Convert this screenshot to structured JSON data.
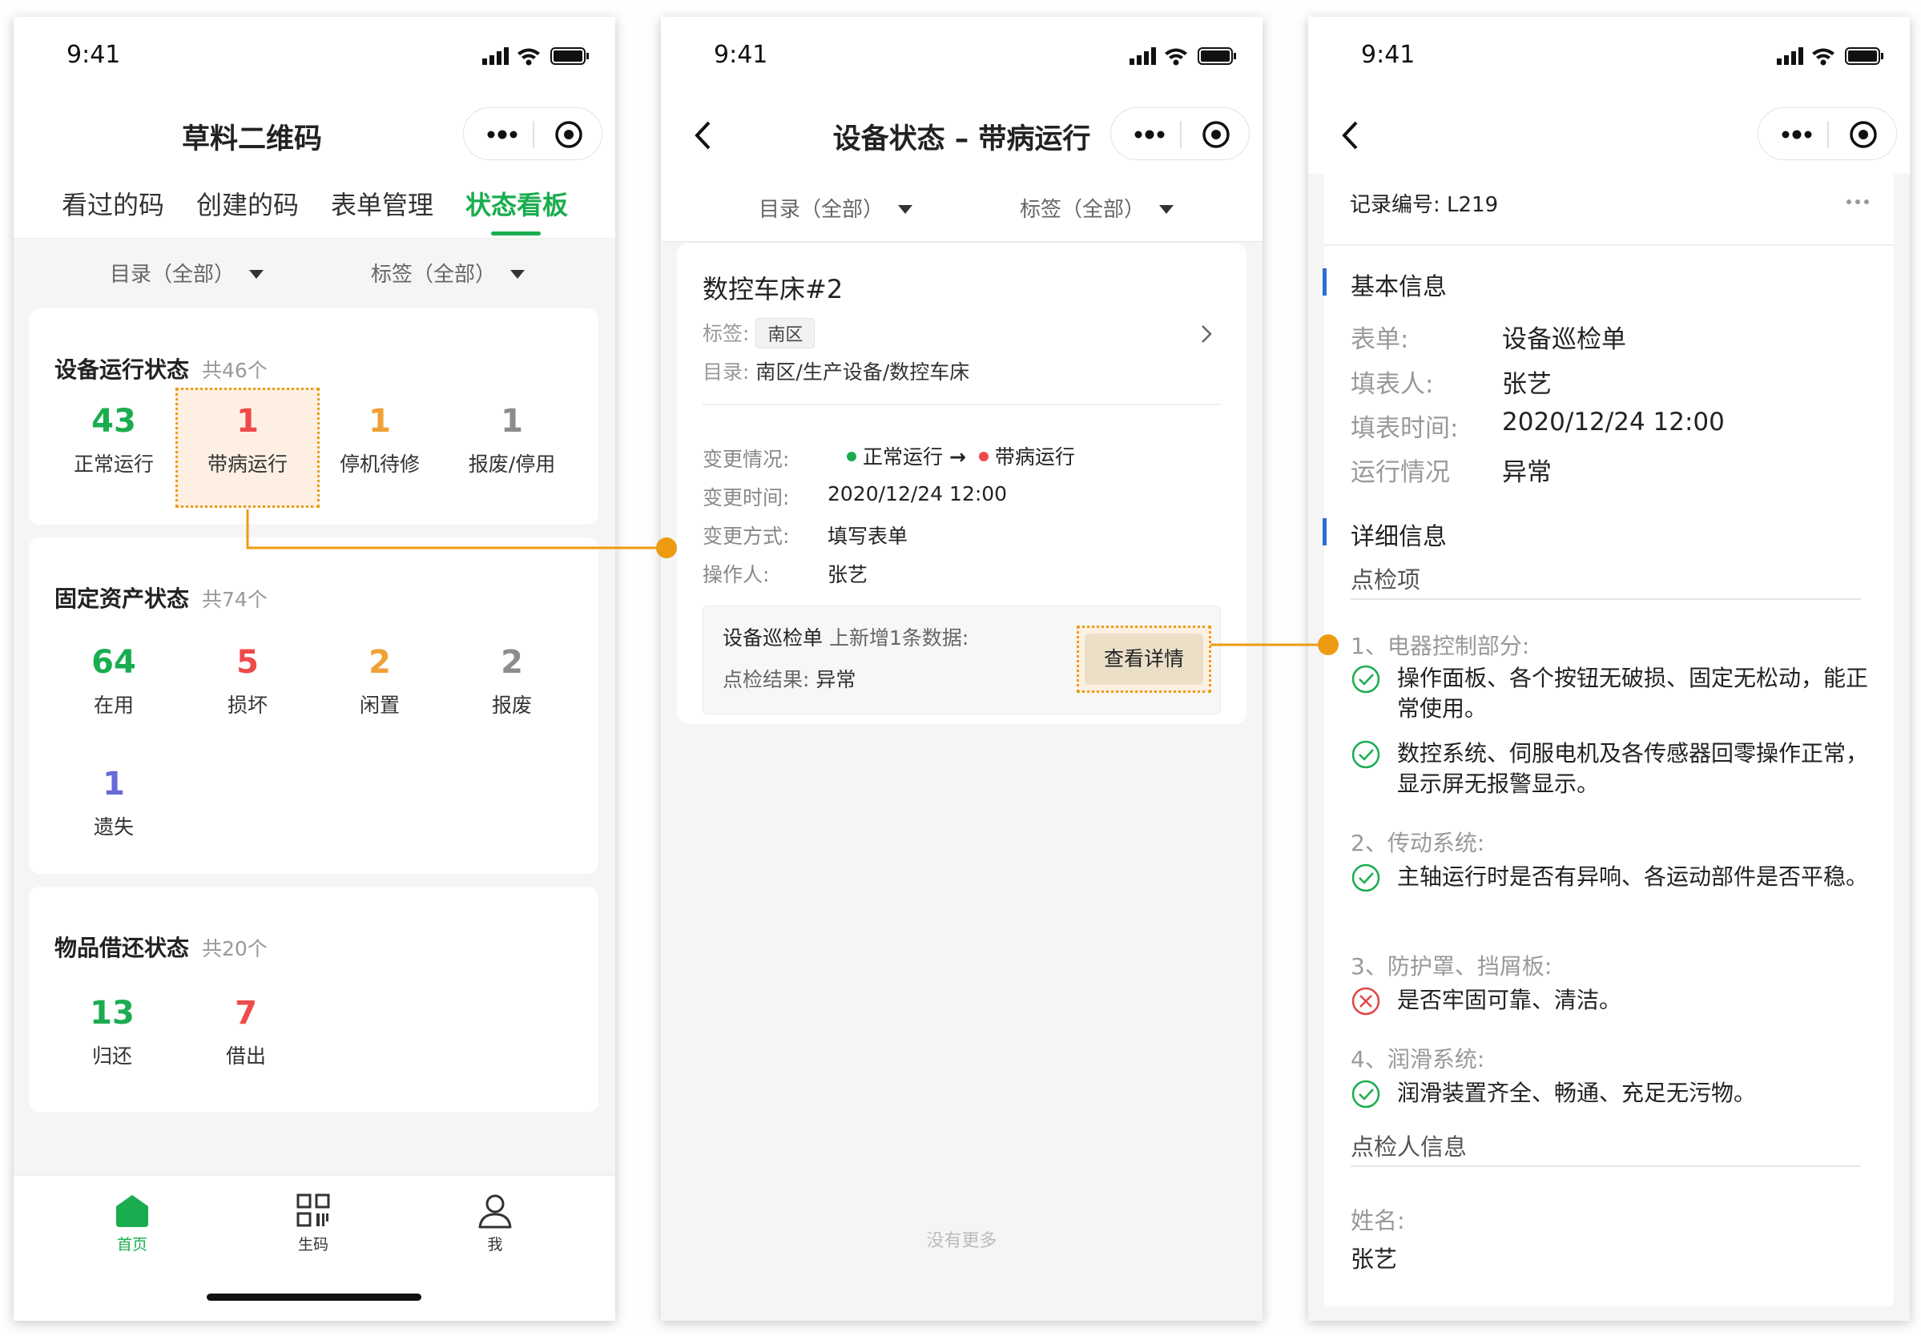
{
  "status_time": "9:41",
  "phone1": {
    "title": "草料二维码",
    "tabs": [
      "看过的码",
      "创建的码",
      "表单管理",
      "状态看板"
    ],
    "filters": [
      "目录（全部）",
      "标签（全部）"
    ],
    "device_status": {
      "title": "设备运行状态",
      "count": "共46个",
      "items": [
        {
          "value": "43",
          "label": "正常运行"
        },
        {
          "value": "1",
          "label": "带病运行"
        },
        {
          "value": "1",
          "label": "停机待修"
        },
        {
          "value": "1",
          "label": "报废/停用"
        }
      ]
    },
    "asset_status": {
      "title": "固定资产状态",
      "count": "共74个",
      "items": [
        {
          "value": "64",
          "label": "在用"
        },
        {
          "value": "5",
          "label": "损坏"
        },
        {
          "value": "2",
          "label": "闲置"
        },
        {
          "value": "2",
          "label": "报废"
        },
        {
          "value": "1",
          "label": "遗失"
        }
      ]
    },
    "borrow_status": {
      "title": "物品借还状态",
      "count": "共20个",
      "items": [
        {
          "value": "13",
          "label": "归还"
        },
        {
          "value": "7",
          "label": "借出"
        }
      ]
    },
    "bottom_nav": [
      "首页",
      "生码",
      "我"
    ]
  },
  "phone2": {
    "title": "设备状态 – 带病运行",
    "filters": [
      "目录（全部）",
      "标签（全部）"
    ],
    "device_name": "数控车床#2",
    "tag_label": "标签:",
    "tag_value": "南区",
    "dir_label": "目录:",
    "dir_value": "南区/生产设备/数控车床",
    "change_label": "变更情况:",
    "change_from": "正常运行",
    "change_arrow": "→",
    "change_to": "带病运行",
    "time_label": "变更时间:",
    "time_value": "2020/12/24 12:00",
    "method_label": "变更方式:",
    "method_value": "填写表单",
    "operator_label": "操作人:",
    "operator_value": "张艺",
    "record_form": "设备巡检单",
    "record_desc": "上新增1条数据:",
    "result_label": "点检结果:",
    "result_value": "异常",
    "detail_button": "查看详情",
    "no_more": "没有更多"
  },
  "phone3": {
    "record_no": "记录编号: L219",
    "basic_title": "基本信息",
    "basic_rows": [
      {
        "label": "表单:",
        "value": "设备巡检单"
      },
      {
        "label": "填表人:",
        "value": "张艺"
      },
      {
        "label": "填表时间:",
        "value": "2020/12/24 12:00"
      },
      {
        "label": "运行情况",
        "value": "异常"
      }
    ],
    "detail_title": "详细信息",
    "inspect_title": "点检项",
    "groups": [
      {
        "title": "1、电器控制部分:",
        "items": [
          {
            "ok": true,
            "text": "操作面板、各个按钮无破损、固定无松动，能正常使用。"
          },
          {
            "ok": true,
            "text": "数控系统、伺服电机及各传感器回零操作正常，显示屏无报警显示。"
          }
        ]
      },
      {
        "title": "2、传动系统:",
        "items": [
          {
            "ok": true,
            "text": "主轴运行时是否有异响、各运动部件是否平稳。"
          }
        ]
      },
      {
        "title": "3、防护罩、挡屑板:",
        "items": [
          {
            "ok": false,
            "text": "是否牢固可靠、清洁。"
          }
        ]
      },
      {
        "title": "4、润滑系统:",
        "items": [
          {
            "ok": true,
            "text": "润滑装置齐全、畅通、充足无污物。"
          }
        ]
      }
    ],
    "inspector_title": "点检人信息",
    "name_label": "姓名:",
    "name_value": "张艺"
  },
  "colors": {
    "green": "#1aad4f",
    "red": "#ef4a4a",
    "orange": "#f0a135",
    "connector": "#ee9b12",
    "section_bar": "#2d6fd4",
    "purple": "#6868d8"
  }
}
